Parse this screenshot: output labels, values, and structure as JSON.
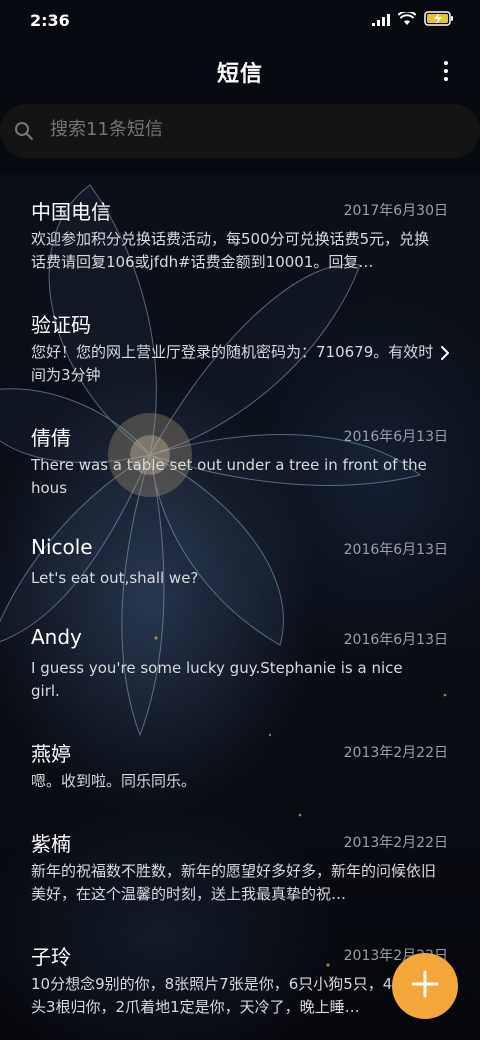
{
  "status_bar": {
    "time": "2:36",
    "icons": [
      "signal-icon",
      "wifi-icon",
      "battery-charging-icon"
    ]
  },
  "header": {
    "title": "短信",
    "more_icon": "more-vertical-icon"
  },
  "search": {
    "placeholder": "搜索11条短信",
    "icon": "search-icon"
  },
  "messages": [
    {
      "name": "中国电信",
      "date": "2017年6月30日",
      "preview": "欢迎参加积分兑换话费活动，每500分可兑换话费5元，兑换话费请回复106或jfdh#话费金额到10001。回复…"
    },
    {
      "name": "验证码",
      "date": "",
      "preview": "您好！您的网上营业厅登录的随机密码为：710679。有效时间为3分钟",
      "chevron": "chevron-right-icon"
    },
    {
      "name": "倩倩",
      "date": "2016年6月13日",
      "preview": "There was a table set out under a tree in front of the hous"
    },
    {
      "name": "Nicole",
      "date": "2016年6月13日",
      "preview": "Let's eat out,shall we?"
    },
    {
      "name": "Andy",
      "date": "2016年6月13日",
      "preview": "I guess you're some lucky guy.Stephanie is a nice girl."
    },
    {
      "name": "燕婷",
      "date": "2013年2月22日",
      "preview": "嗯。收到啦。同乐同乐。"
    },
    {
      "name": "紫楠",
      "date": "2013年2月22日",
      "preview": "新年的祝福数不胜数，新年的愿望好多好多，新年的问候依旧美好，在这个温馨的时刻，送上我最真挚的祝…"
    },
    {
      "name": "子玲",
      "date": "2013年2月22日",
      "preview": "10分想念9别的你，8张照片7张是你，6只小狗5只，4根骨头3根归你，2爪着地1定是你，天冷了，晚上睡…"
    }
  ],
  "fab": {
    "icon": "plus-icon"
  },
  "colors": {
    "accent": "#f3a73a",
    "background": "#070a10",
    "search_bg": "#141414",
    "date_text": "#9aa0a8"
  }
}
